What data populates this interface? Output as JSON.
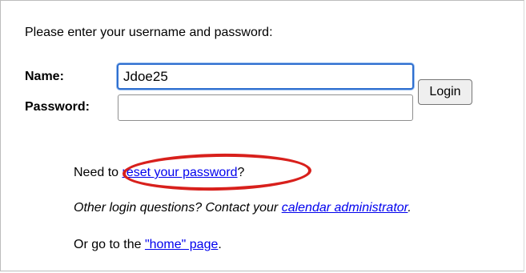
{
  "login": {
    "prompt": "Please enter your username and password:",
    "name_label": "Name:",
    "name_value": "Jdoe25",
    "password_label": "Password:",
    "password_value": "",
    "login_button": "Login"
  },
  "help": {
    "reset_prefix": "Need to ",
    "reset_link": "reset your password",
    "reset_suffix": "?",
    "other_prefix": "Other login questions? Contact your ",
    "other_link": "calendar administrator",
    "other_suffix": ".",
    "home_prefix": "Or go to the ",
    "home_link": "\"home\" page",
    "home_suffix": "."
  },
  "annotation": {
    "highlight_color": "#d8201c"
  }
}
